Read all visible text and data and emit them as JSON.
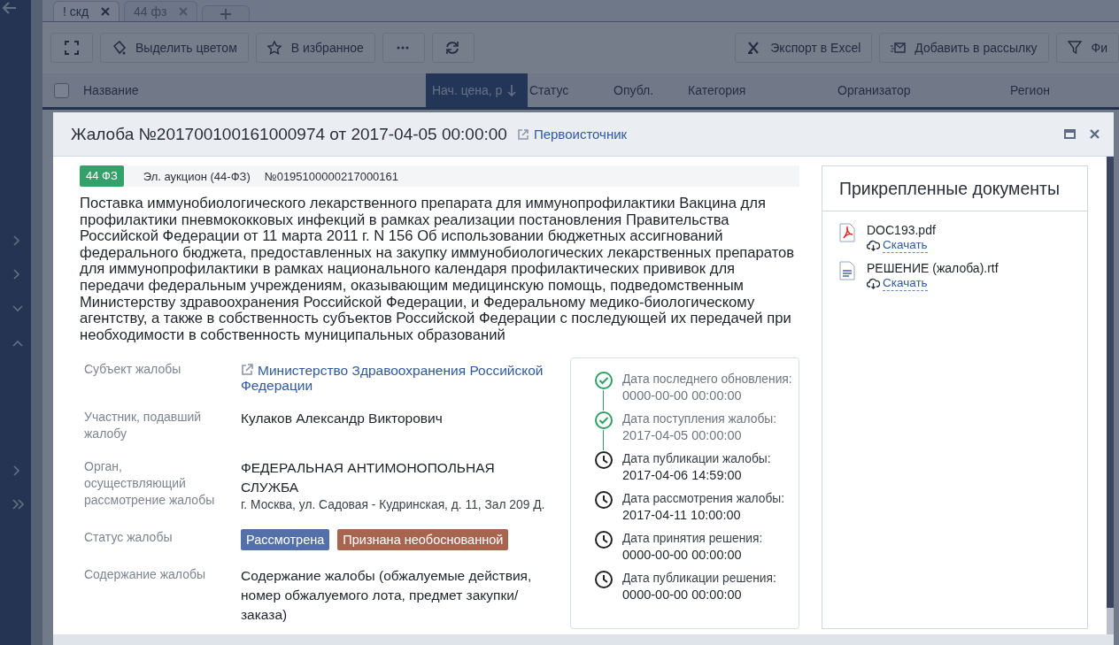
{
  "tabs": [
    {
      "label": "! скд",
      "selected": true
    },
    {
      "label": "44 фз",
      "selected": false
    }
  ],
  "toolbar": {
    "left": [
      {
        "kind": "expand"
      },
      {
        "kind": "color",
        "label": "Выделить цветом"
      },
      {
        "kind": "star",
        "label": "В избранное"
      },
      {
        "kind": "more"
      },
      {
        "kind": "refresh"
      }
    ],
    "right": [
      {
        "kind": "excel",
        "label": "Экспорт в Excel"
      },
      {
        "kind": "mail",
        "label": "Добавить в рассылку"
      },
      {
        "kind": "filter",
        "label": "Фи"
      }
    ]
  },
  "table": {
    "all_checked": false,
    "columns": [
      {
        "label": "Название",
        "sorted": false
      },
      {
        "label": "Нач. цена, р",
        "sorted": true
      },
      {
        "label": "Статус",
        "sorted": false
      },
      {
        "label": "Опубл.",
        "sorted": false
      },
      {
        "label": "Категория",
        "sorted": false
      },
      {
        "label": "Организатор",
        "sorted": false
      },
      {
        "label": "Регион",
        "sorted": false
      }
    ]
  },
  "dialog": {
    "title": "Жалоба №201700100161000974 от 2017-04-05 00:00:00",
    "source_link": "Первоисточник",
    "badge": "44 ФЗ",
    "procedure": "Эл. аукцион (44-ФЗ)",
    "number": "№0195100000217000161",
    "description": "Поставка иммунобиологического лекарственного препарата для иммунопрофилактики Вакцина для профилактики пневмококковых инфекций в рамках реализации постановления Правительства Российской Федерации от 11 марта 2011 г. N 156 Об использовании бюджетных ассигнований федерального бюджета, предоставленных на закупку иммунобиологических лекарственных препаратов для иммунопрофилактики в рамках национального календаря профилактических прививок для передачи федеральным учреждениям, оказывающим медицинскую помощь, подведомственным Министерству здравоохранения Российской Федерации, и Федеральному медико-биологическому агентству, а также в собственность субъектов Российской Федерации с последующей их передачей при необходимости в собственность муниципальных образований",
    "fields": [
      {
        "kind": "link",
        "label": "Субъект жалобы",
        "value": "Министерство Здравоохранения Российской Федерации"
      },
      {
        "kind": "text",
        "label": "Участник, подавший жалобу",
        "value": "Кулаков Александр Викторович"
      },
      {
        "kind": "org",
        "label": "Орган, осуществляющий рассмотрение жалобы",
        "value": "ФЕДЕРАЛЬНАЯ АНТИМОНОПОЛЬНАЯ СЛУЖБА",
        "address": "г. Москва, ул. Садовая - Кудринская, д. 11, Зал 209 Д."
      },
      {
        "kind": "tags",
        "label": "Статус жалобы",
        "tags": [
          {
            "label": "Рассмотрена",
            "color": "#5470a8"
          },
          {
            "label": "Признана необоснованной",
            "color": "#a7644f"
          }
        ]
      },
      {
        "kind": "text",
        "label": "Содержание жалобы",
        "value": "Содержание жалобы (обжалуемые действия, номер обжалуемого лота, предмет закупки/ заказа)"
      }
    ],
    "timeline": [
      {
        "label": "Дата последнего обновления:",
        "value": "0000-00-00 00:00:00",
        "done": true
      },
      {
        "label": "Дата поступления жалобы:",
        "value": "2017-04-05 00:00:00",
        "done": true
      },
      {
        "label": "Дата публикации жалобы:",
        "value": "2017-04-06 14:59:00",
        "done": false
      },
      {
        "label": "Дата рассмотрения жалобы:",
        "value": "2017-04-11 10:00:00",
        "done": false
      },
      {
        "label": "Дата принятия решения:",
        "value": "0000-00-00 00:00:00",
        "done": false
      },
      {
        "label": "Дата публикации решения:",
        "value": "0000-00-00 00:00:00",
        "done": false
      }
    ],
    "documents": {
      "title": "Прикрепленные документы",
      "items": [
        {
          "kind": "pdf",
          "name": "DOC193.pdf",
          "action": "Скачать"
        },
        {
          "kind": "text",
          "name": "РЕШЕНИЕ (жалоба).rtf",
          "action": "Скачать"
        }
      ]
    }
  }
}
